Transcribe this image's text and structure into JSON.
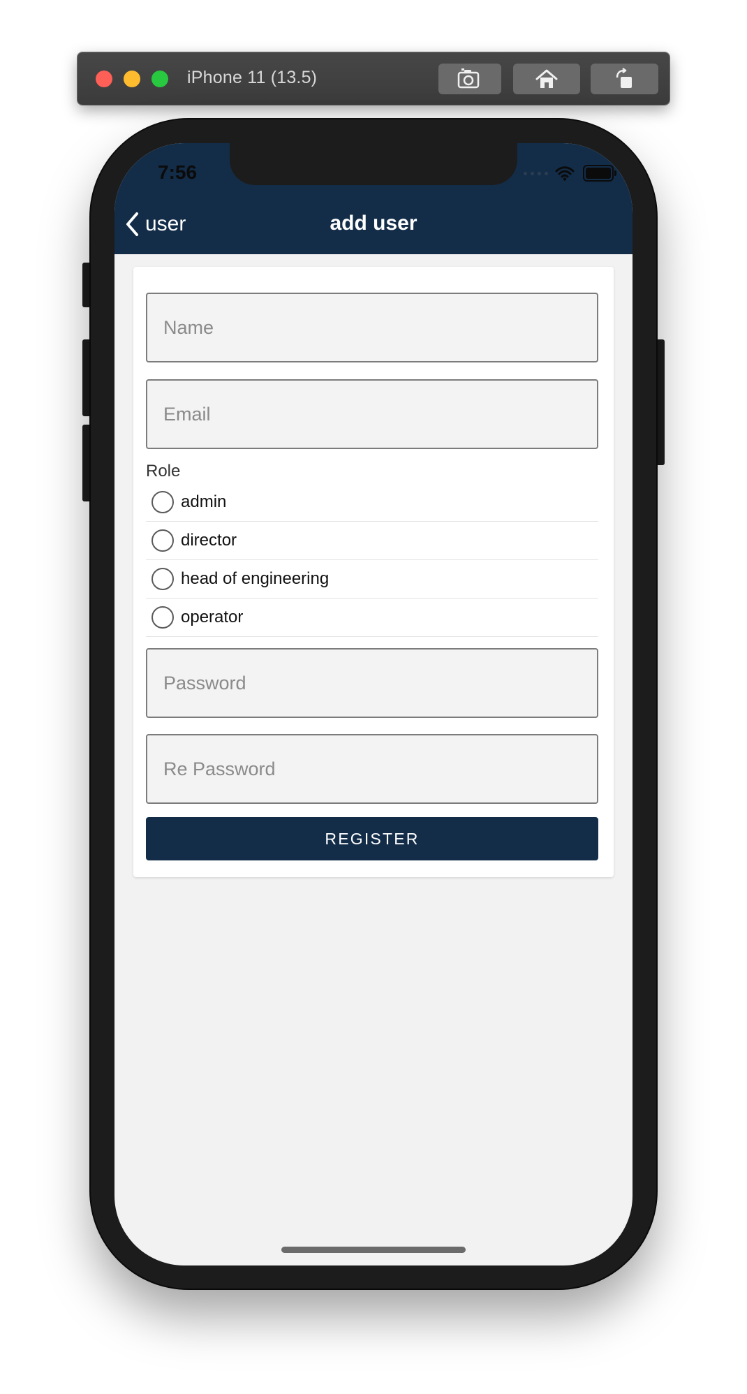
{
  "simulator": {
    "title": "iPhone 11 (13.5)",
    "buttons": [
      "screenshot",
      "home",
      "rotate"
    ]
  },
  "status_bar": {
    "time": "7:56"
  },
  "nav": {
    "back_label": "user",
    "title": "add user"
  },
  "form": {
    "name_placeholder": "Name",
    "email_placeholder": "Email",
    "role_label": "Role",
    "roles": [
      "admin",
      "director",
      "head of engineering",
      "operator"
    ],
    "password_placeholder": "Password",
    "repassword_placeholder": "Re Password",
    "register_label": "REGISTER"
  },
  "colors": {
    "brand": "#132d49",
    "background": "#f2f2f2"
  }
}
